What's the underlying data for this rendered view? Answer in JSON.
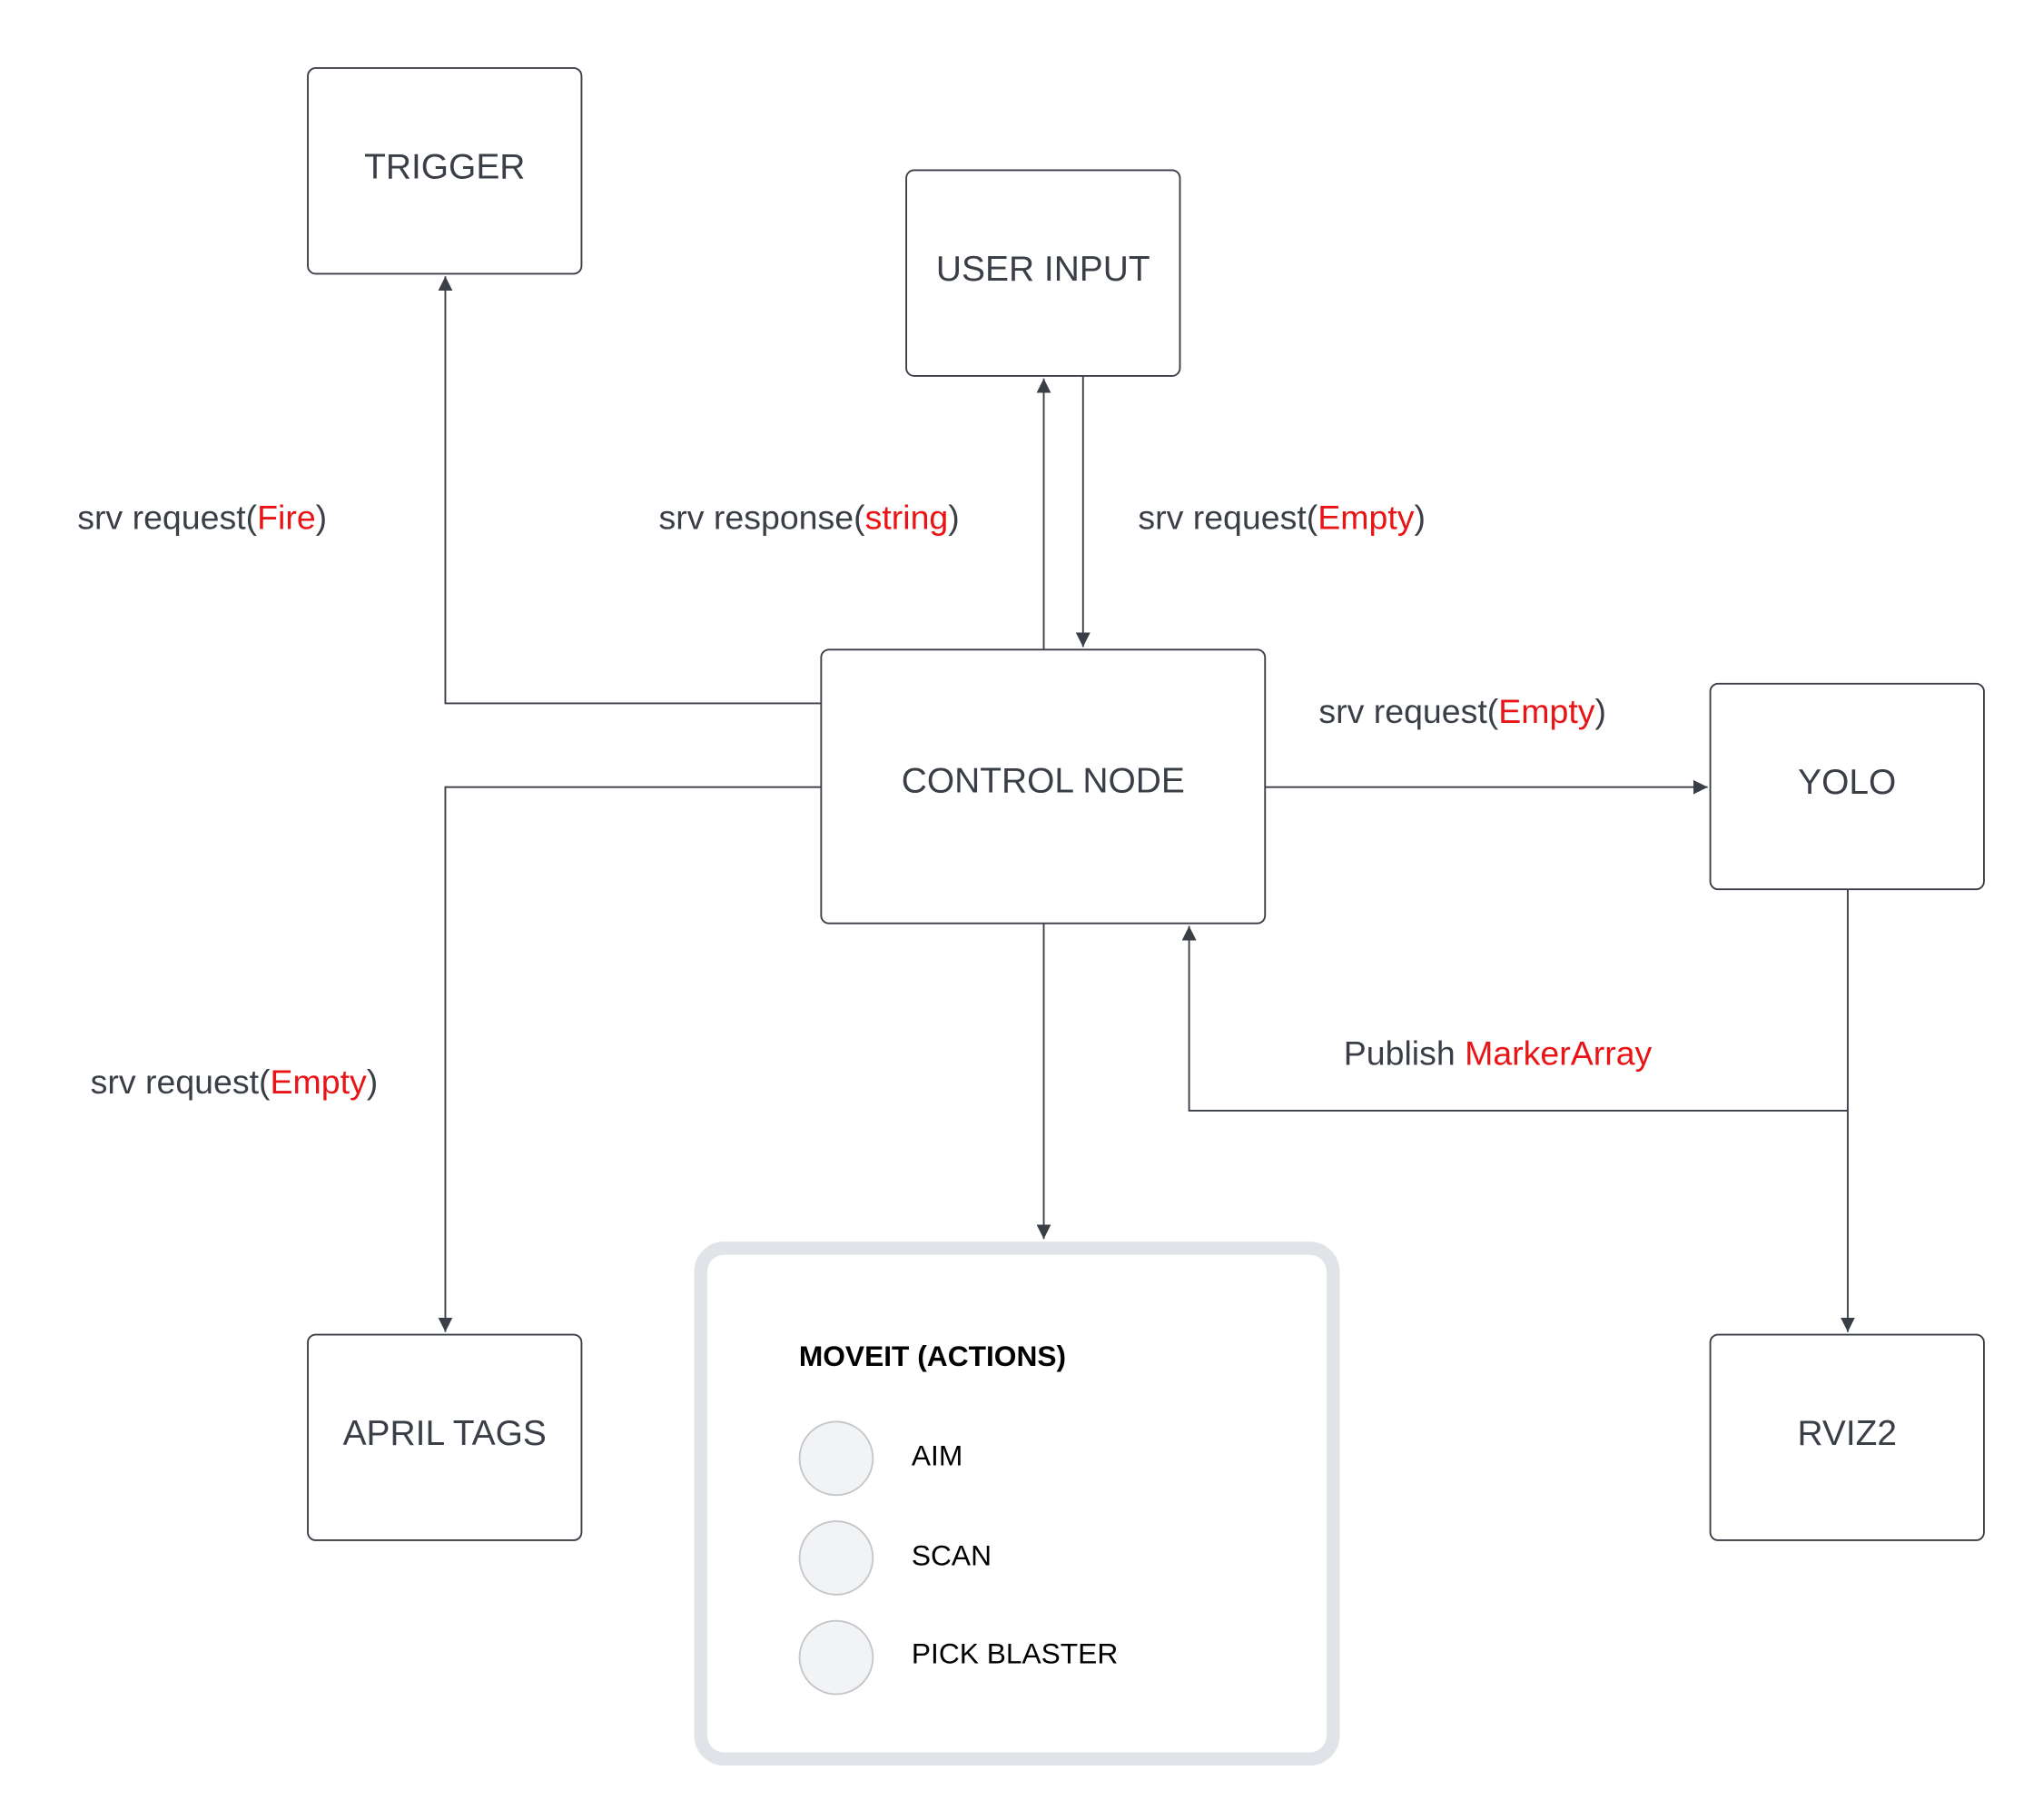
{
  "nodes": {
    "trigger": "TRIGGER",
    "user_input": "USER INPUT",
    "control_node": "CONTROL NODE",
    "yolo": "YOLO",
    "april_tags": "APRIL TAGS",
    "rviz2": "RVIZ2"
  },
  "edges": {
    "fire": {
      "prefix": "srv request(",
      "type": "Fire",
      "suffix": ")"
    },
    "response_string": {
      "prefix": "srv response(",
      "type": "string",
      "suffix": ")"
    },
    "user_request": {
      "prefix": "srv request(",
      "type": "Empty",
      "suffix": ")"
    },
    "yolo_request": {
      "prefix": "srv request(",
      "type": "Empty",
      "suffix": ")"
    },
    "publish": {
      "prefix": "Publish ",
      "type": "MarkerArray",
      "suffix": ""
    },
    "april_request": {
      "prefix": "srv request(",
      "type": "Empty",
      "suffix": ")"
    }
  },
  "moveit": {
    "title": "MOVEIT (ACTIONS)",
    "actions": [
      "AIM",
      "SCAN",
      "PICK BLASTER"
    ]
  },
  "colors": {
    "text": "#3a3f47",
    "highlight": "#e81416",
    "container_border": "#e0e3e8",
    "action_circle": "#f2f3f5"
  }
}
